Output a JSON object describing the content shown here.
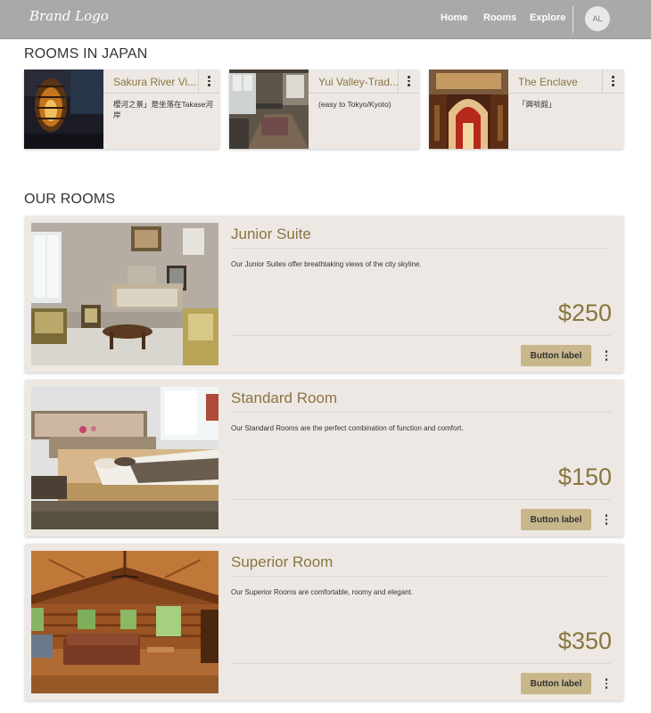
{
  "header": {
    "brand": "Brand Logo",
    "nav": [
      "Home",
      "Rooms",
      "Explore"
    ],
    "avatar_initials": "AL"
  },
  "rooms_in_japan": {
    "title": "ROOMS IN JAPAN",
    "cards": [
      {
        "title": "Sakura River Vi...",
        "description": "櫻河之景」是坐落在Takase河岸",
        "icon": "more-vertical-icon"
      },
      {
        "title": "Yui Valley-Trad...",
        "description": "(easy to Tokyo/Kyoto)",
        "icon": "more-vertical-icon"
      },
      {
        "title": "The Enclave",
        "description": "「興啖館」",
        "icon": "more-vertical-icon"
      }
    ]
  },
  "our_rooms": {
    "title": "OUR ROOMS",
    "cards": [
      {
        "title": "Junior Suite",
        "description": "Our Junior Suites offer breathtaking views of the city skyline.",
        "price": "$250",
        "button": "Button label"
      },
      {
        "title": "Standard Room",
        "description": "Our Standard Rooms are the perfect combination of function and comfort.",
        "price": "$150",
        "button": "Button label"
      },
      {
        "title": "Superior Room",
        "description": "Our Superior Rooms are comfortable, roomy and elegant.",
        "price": "$350",
        "button": "Button label"
      }
    ]
  },
  "colors": {
    "header_bg": "#a9a9a9",
    "card_bg": "#ede8e4",
    "accent_text": "#8a7540",
    "button_bg": "#c7b78a"
  }
}
